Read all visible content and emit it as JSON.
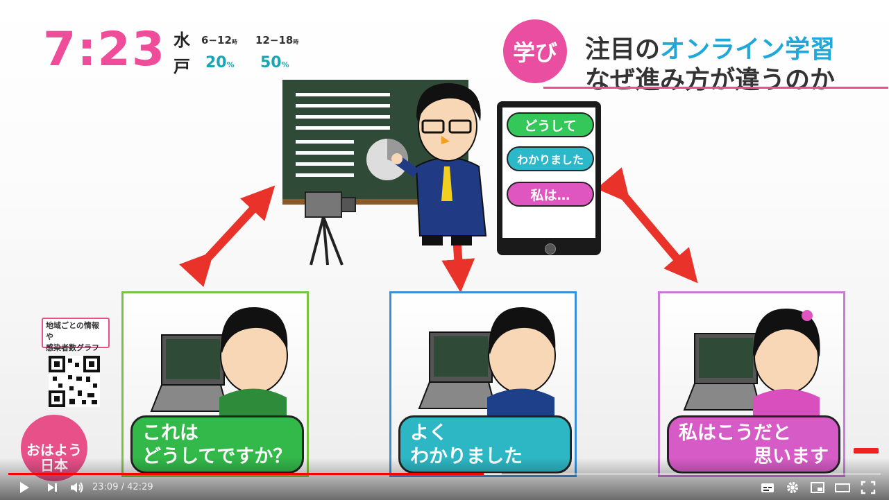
{
  "overlay": {
    "clock": "7:23",
    "weather": {
      "day": "水",
      "rain_label": "戸",
      "period1": "6−12",
      "period2": "12−18",
      "unit": "時",
      "chance1": "20",
      "chance2": "50",
      "percent": "%"
    },
    "badge": "学び",
    "title_pre": "注目の",
    "title_highlight": "オンライン学習",
    "subtitle": "なぜ進み方が違うのか",
    "qr_text_1": "地域ごとの情報や",
    "qr_text_2": "感染者数グラフ",
    "logo_line1": "おはよう",
    "logo_line2": "日本"
  },
  "phone_bubbles": [
    {
      "text": "どうして",
      "color": "#34c759"
    },
    {
      "text": "わかりました",
      "color": "#2bb8c8"
    },
    {
      "text": "私は…",
      "color": "#e056c1"
    }
  ],
  "students": [
    {
      "line1": "これは",
      "line2": "どうしてですか？",
      "border": "#7cc242",
      "bubble": "#33b84a"
    },
    {
      "line1": "よく",
      "line2": "わかりました",
      "border": "#3a8fd9",
      "bubble": "#2db7c4"
    },
    {
      "line1": "私はこうだと",
      "line2": "思います",
      "border": "#c77ad6",
      "bubble": "#d65bc6"
    }
  ],
  "player": {
    "current_time": "23:09",
    "separator": "/",
    "duration": "42:29",
    "progress": 0.545
  },
  "icons": {
    "play": "play-icon",
    "next": "next-icon",
    "volume": "volume-icon",
    "subtitles": "subtitles-icon",
    "settings": "settings-icon",
    "miniplayer": "miniplayer-icon",
    "theater": "theater-icon",
    "fullscreen": "fullscreen-icon"
  }
}
